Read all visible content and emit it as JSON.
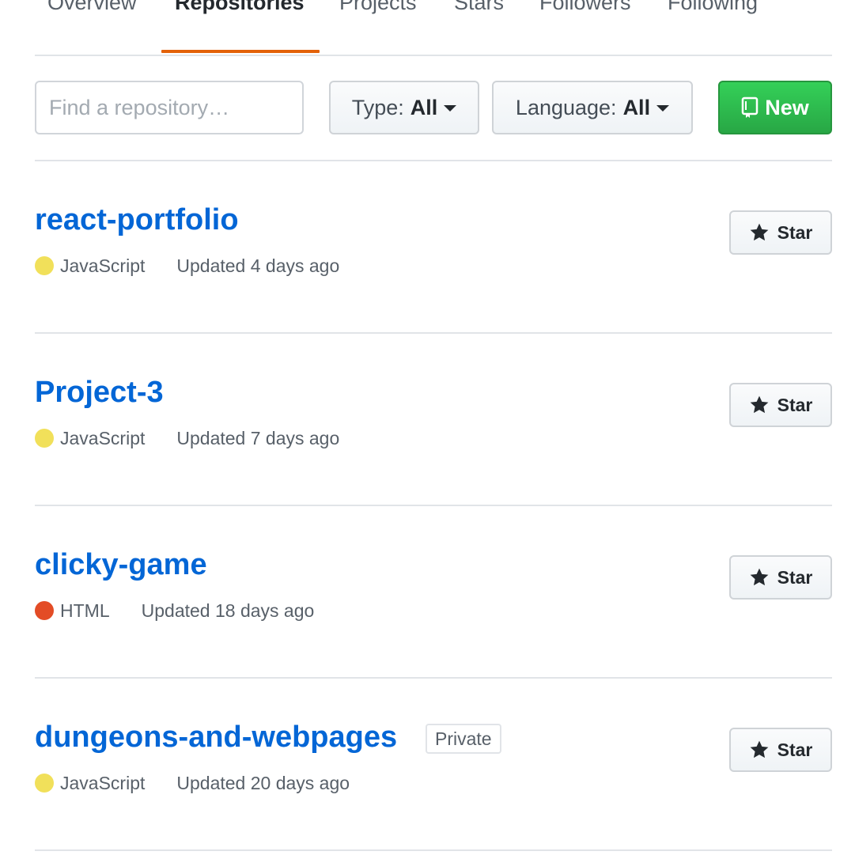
{
  "tabs": [
    {
      "label": "Overview",
      "selected": false
    },
    {
      "label": "Repositories",
      "selected": true
    },
    {
      "label": "Projects",
      "selected": false
    },
    {
      "label": "Stars",
      "selected": false
    },
    {
      "label": "Followers",
      "selected": false
    },
    {
      "label": "Following",
      "selected": false
    }
  ],
  "filters": {
    "search_placeholder": "Find a repository…",
    "type_label": "Type:",
    "type_value": "All",
    "language_label": "Language:",
    "language_value": "All",
    "new_label": "New"
  },
  "colors": {
    "accent_tab": "#e36209",
    "link": "#0366d6",
    "new_button": "#2ea44f"
  },
  "repos": [
    {
      "name": "react-portfolio",
      "private": false,
      "language": "JavaScript",
      "language_color": "#f1e05a",
      "updated": "Updated 4 days ago",
      "star_label": "Star"
    },
    {
      "name": "Project-3",
      "private": false,
      "language": "JavaScript",
      "language_color": "#f1e05a",
      "updated": "Updated 7 days ago",
      "star_label": "Star"
    },
    {
      "name": "clicky-game",
      "private": false,
      "language": "HTML",
      "language_color": "#e34c26",
      "updated": "Updated 18 days ago",
      "star_label": "Star"
    },
    {
      "name": "dungeons-and-webpages",
      "private": true,
      "private_label": "Private",
      "language": "JavaScript",
      "language_color": "#f1e05a",
      "updated": "Updated 20 days ago",
      "star_label": "Star"
    }
  ]
}
